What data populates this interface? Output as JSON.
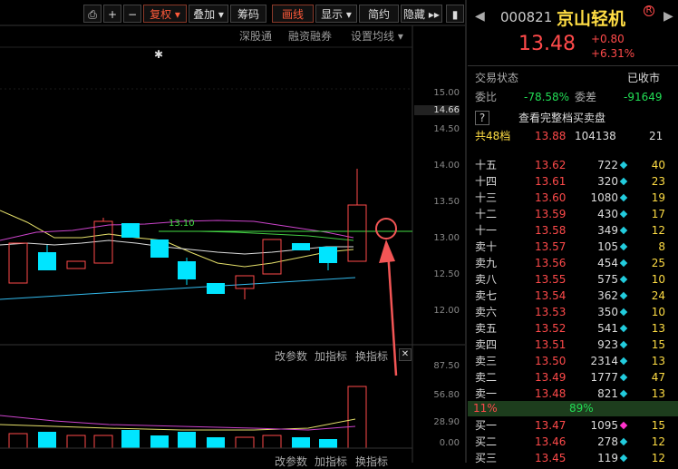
{
  "toolbar": {
    "buttons": [
      "复权",
      "叠加",
      "筹码",
      "画线",
      "显示",
      "简约",
      "隐藏"
    ],
    "subs": [
      "深股通",
      "融资融券",
      "设置均线"
    ]
  },
  "chart": {
    "price_axis": [
      "15.00",
      "14.66",
      "14.50",
      "14.00",
      "13.50",
      "13.00",
      "12.50",
      "12.00"
    ],
    "ma_label": "13.10",
    "param_btn": "改参数",
    "add_ind_btn": "加指标",
    "change_ind_btn": "换指标",
    "vol_axis": [
      "87.50",
      "56.80",
      "28.90",
      "0.00"
    ],
    "bottom_links": [
      "改参数",
      "加指标",
      "换指标"
    ]
  },
  "stock": {
    "code": "000821",
    "name": "京山轻机",
    "price": "13.48",
    "change": "+0.80",
    "change_pct": "+6.31%",
    "status_label": "交易状态",
    "status_value": "已收市",
    "wb_label": "委比",
    "wb_value": "-78.58%",
    "wc_label": "委差",
    "wc_value": "-91649",
    "full_book": "查看完整档买卖盘",
    "total_levels": "共48档",
    "total_price": "13.88",
    "total_vol": "104138",
    "total_cnt": "21"
  },
  "order_book": [
    {
      "label": "十五",
      "price": "13.62",
      "vol": "722",
      "mark": "cyan",
      "cnt": "40"
    },
    {
      "label": "十四",
      "price": "13.61",
      "vol": "320",
      "mark": "cyan",
      "cnt": "23"
    },
    {
      "label": "十三",
      "price": "13.60",
      "vol": "1080",
      "mark": "cyan",
      "cnt": "19"
    },
    {
      "label": "十二",
      "price": "13.59",
      "vol": "430",
      "mark": "cyan",
      "cnt": "17"
    },
    {
      "label": "十一",
      "price": "13.58",
      "vol": "349",
      "mark": "cyan",
      "cnt": "12"
    },
    {
      "label": "卖十",
      "price": "13.57",
      "vol": "105",
      "mark": "cyan",
      "cnt": "8"
    },
    {
      "label": "卖九",
      "price": "13.56",
      "vol": "454",
      "mark": "cyan",
      "cnt": "25"
    },
    {
      "label": "卖八",
      "price": "13.55",
      "vol": "575",
      "mark": "cyan",
      "cnt": "10"
    },
    {
      "label": "卖七",
      "price": "13.54",
      "vol": "362",
      "mark": "cyan",
      "cnt": "24"
    },
    {
      "label": "卖六",
      "price": "13.53",
      "vol": "350",
      "mark": "cyan",
      "cnt": "10"
    },
    {
      "label": "卖五",
      "price": "13.52",
      "vol": "541",
      "mark": "cyan",
      "cnt": "13"
    },
    {
      "label": "卖四",
      "price": "13.51",
      "vol": "923",
      "mark": "cyan",
      "cnt": "15"
    },
    {
      "label": "卖三",
      "price": "13.50",
      "vol": "2314",
      "mark": "cyan",
      "cnt": "13"
    },
    {
      "label": "卖二",
      "price": "13.49",
      "vol": "1777",
      "mark": "cyan",
      "cnt": "47"
    },
    {
      "label": "卖一",
      "price": "13.48",
      "vol": "821",
      "mark": "cyan",
      "cnt": "13"
    }
  ],
  "ratio": {
    "left": "11%",
    "right": "89%"
  },
  "buy_book": [
    {
      "label": "买一",
      "price": "13.47",
      "vol": "1095",
      "mark": "magenta",
      "cnt": "15"
    },
    {
      "label": "买二",
      "price": "13.46",
      "vol": "278",
      "mark": "cyan",
      "cnt": "12"
    },
    {
      "label": "买三",
      "price": "13.45",
      "vol": "119",
      "mark": "cyan",
      "cnt": "12"
    }
  ]
}
